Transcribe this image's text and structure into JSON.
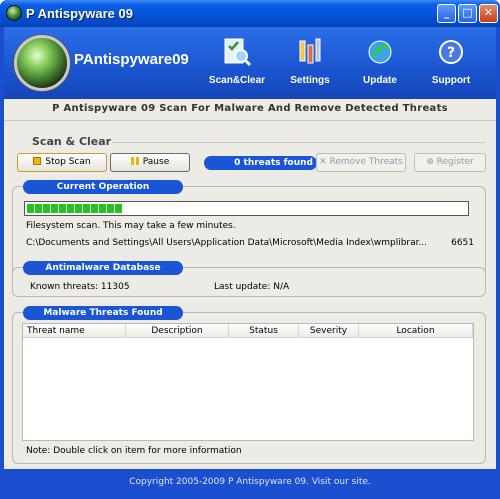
{
  "window": {
    "title": "P Antispyware 09",
    "min": "_",
    "max": "□",
    "close": "✕"
  },
  "header": {
    "app_name": "PAntispyware09",
    "nav": [
      {
        "label": "Scan&Clear",
        "icon": "scan-clear-icon"
      },
      {
        "label": "Settings",
        "icon": "settings-icon"
      },
      {
        "label": "Update",
        "icon": "update-icon"
      },
      {
        "label": "Support",
        "icon": "support-icon"
      }
    ]
  },
  "subtitle": "P Antispyware 09 Scan For Malware And Remove Detected Threats",
  "scan_clear": {
    "heading": "Scan & Clear",
    "stop_label": "Stop Scan",
    "pause_label": "Pause",
    "threats_found": "0 threats found",
    "remove_label": "Remove Threats",
    "register_label": "Register"
  },
  "current_operation": {
    "label": "Current Operation",
    "progress_blocks": 12,
    "message": "Filesystem scan. This may take a few minutes.",
    "path": "C:\\Documents and Settings\\All Users\\Application Data\\Microsoft\\Media Index\\wmplibrar...",
    "count": "6651"
  },
  "database": {
    "label": "Antimalware Database",
    "known_threats": "Known threats: 11305",
    "last_update": "Last update: N/A"
  },
  "threats": {
    "label": "Malware Threats Found",
    "columns": [
      "Threat name",
      "Description",
      "Status",
      "Severity",
      "Location"
    ],
    "note": "Note: Double click on item for more information"
  },
  "footer": "Copyright 2005-2009 P Antispyware 09. Visit our site."
}
